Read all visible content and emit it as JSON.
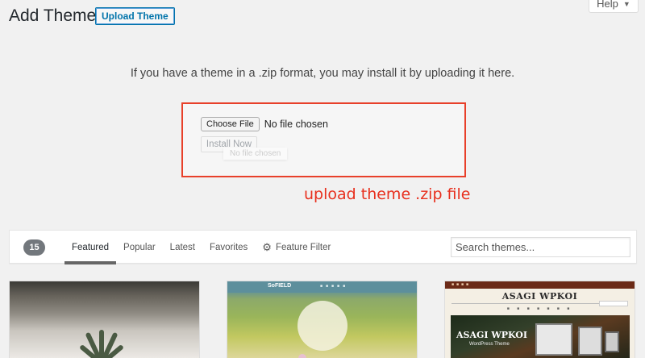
{
  "header": {
    "title": "Add Themes",
    "upload_button": "Upload Theme",
    "help_label": "Help",
    "help_caret": "▼"
  },
  "upload": {
    "description": "If you have a theme in a .zip format, you may install it by uploading it here.",
    "choose_file_label": "Choose File",
    "file_status": "No file chosen",
    "install_label": "Install Now",
    "ghost_text": "No file chosen"
  },
  "annotation": {
    "text": "upload theme .zip file",
    "color": "#e8301e"
  },
  "filter": {
    "count": "15",
    "tabs": [
      {
        "label": "Featured",
        "active": true
      },
      {
        "label": "Popular",
        "active": false
      },
      {
        "label": "Latest",
        "active": false
      },
      {
        "label": "Favorites",
        "active": false
      }
    ],
    "feature_filter_label": "Feature Filter",
    "feature_filter_icon": "gear-icon",
    "search_placeholder": "Search themes..."
  },
  "themes": {
    "card2_logo": "SoFIELD",
    "card3_title": "ASAGI WPKOI",
    "card3_hero_text": "ASAGI WPKOI",
    "card3_hero_sub": "WordPress Theme"
  },
  "colors": {
    "accent": "#0073aa",
    "annotation_border": "#e8402a",
    "badge_bg": "#72777c"
  }
}
